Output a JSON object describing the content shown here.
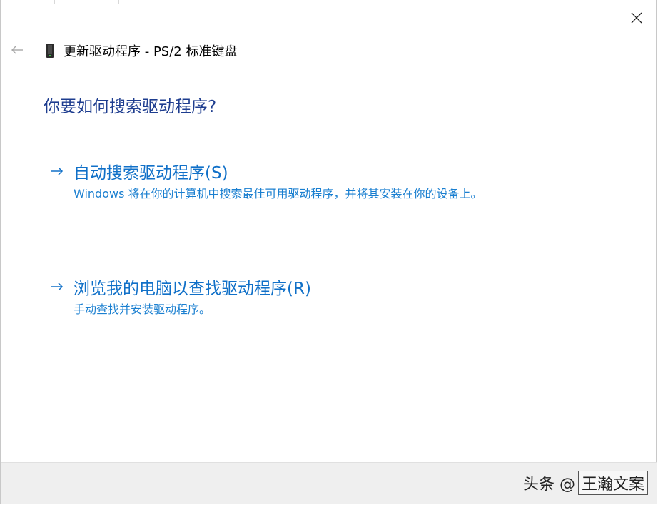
{
  "window": {
    "title": "更新驱动程序 - PS/2 标准键盘",
    "close_icon": "close-icon",
    "back_icon": "back-arrow-icon",
    "device_icon": "keyboard-device-icon"
  },
  "main": {
    "question": "你要如何搜索驱动程序?",
    "options": [
      {
        "label": "自动搜索驱动程序(S)",
        "description": "Windows 将在你的计算机中搜索最佳可用驱动程序，并将其安装在你的设备上。",
        "icon": "arrow-right-icon"
      },
      {
        "label": "浏览我的电脑以查找驱动程序(R)",
        "description": "手动查找并安装驱动程序。",
        "icon": "arrow-right-icon"
      }
    ]
  },
  "watermark": {
    "prefix": "头条 @",
    "name": "王瀚文案"
  },
  "colors": {
    "question": "#1e3d8f",
    "option_label": "#1070c8",
    "option_desc": "#1a7fd0",
    "footer_bg": "#efefef"
  }
}
